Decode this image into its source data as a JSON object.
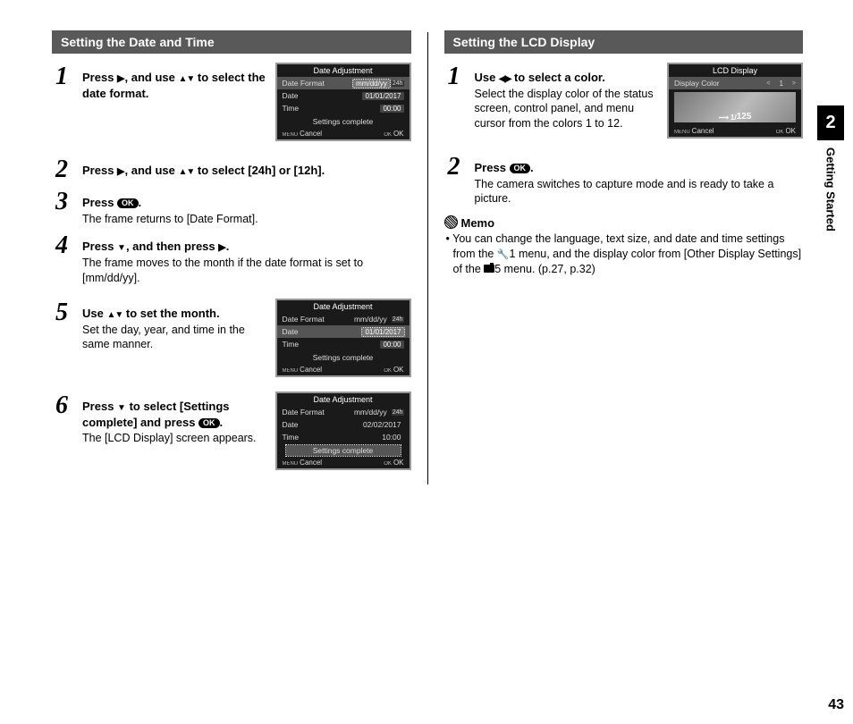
{
  "sidebar": {
    "chapter": "2",
    "label": "Getting Started"
  },
  "pageNumber": "43",
  "left": {
    "heading": "Setting the Date and Time",
    "steps": {
      "s1": {
        "num": "1",
        "title_a": "Press ",
        "title_b": ", and use ",
        "title_c": " to select the date format."
      },
      "s2": {
        "num": "2",
        "title_a": "Press ",
        "title_b": ", and use ",
        "title_c": " to select [24h] or [12h]."
      },
      "s3": {
        "num": "3",
        "title_a": "Press ",
        "title_b": ".",
        "desc": "The frame returns to [Date Format]."
      },
      "s4": {
        "num": "4",
        "title_a": "Press ",
        "title_b": ", and then press ",
        "title_c": ".",
        "desc": "The frame moves to the month if the date format is set to [mm/dd/yy]."
      },
      "s5": {
        "num": "5",
        "title_a": "Use ",
        "title_b": " to set the month.",
        "desc": "Set the day, year, and time in the same manner."
      },
      "s6": {
        "num": "6",
        "title_a": "Press ",
        "title_b": " to select [Settings complete] and press ",
        "title_c": ".",
        "desc": "The [LCD Display] screen appears."
      }
    },
    "lcd1": {
      "title": "Date Adjustment",
      "rows": {
        "fmt_label": "Date Format",
        "fmt_val": "mm/dd/yy",
        "fmt_hr": "24h",
        "date_label": "Date",
        "date_val": "01/01/2017",
        "time_label": "Time",
        "time_val": "00:00"
      },
      "settings": "Settings complete",
      "cancel": "Cancel",
      "menu": "MENU",
      "ok": "OK"
    },
    "lcd2": {
      "title": "Date Adjustment",
      "rows": {
        "fmt_label": "Date Format",
        "fmt_val": "mm/dd/yy",
        "fmt_hr": "24h",
        "date_label": "Date",
        "date_val": "01/01/2017",
        "time_label": "Time",
        "time_val": "00:00"
      },
      "settings": "Settings complete",
      "cancel": "Cancel",
      "menu": "MENU",
      "ok": "OK"
    },
    "lcd3": {
      "title": "Date Adjustment",
      "rows": {
        "fmt_label": "Date Format",
        "fmt_val": "mm/dd/yy",
        "fmt_hr": "24h",
        "date_label": "Date",
        "date_val": "02/02/2017",
        "time_label": "Time",
        "time_val": "10:00"
      },
      "settings": "Settings complete",
      "cancel": "Cancel",
      "menu": "MENU",
      "ok": "OK"
    }
  },
  "right": {
    "heading": "Setting the LCD Display",
    "steps": {
      "s1": {
        "num": "1",
        "title_a": "Use ",
        "title_b": " to select a color.",
        "desc": "Select the display color of the status screen, control panel, and menu cursor from the colors 1 to 12."
      },
      "s2": {
        "num": "2",
        "title_a": "Press ",
        "title_b": ".",
        "desc": "The camera switches to capture mode and is ready to take a picture."
      }
    },
    "lcd": {
      "title": "LCD Display",
      "color_label": "Display Color",
      "color_val": "1",
      "preview_iso": "1/",
      "preview_speed": "125",
      "cancel": "Cancel",
      "menu": "MENU",
      "ok": "OK"
    },
    "memo": {
      "head": "Memo",
      "body_a": "• You can change the language, text size, and date and time settings from the ",
      "body_b": "1 menu, and the display color from [Other Display Settings] of the ",
      "body_c": "5 menu. (p.27, p.32)"
    }
  }
}
